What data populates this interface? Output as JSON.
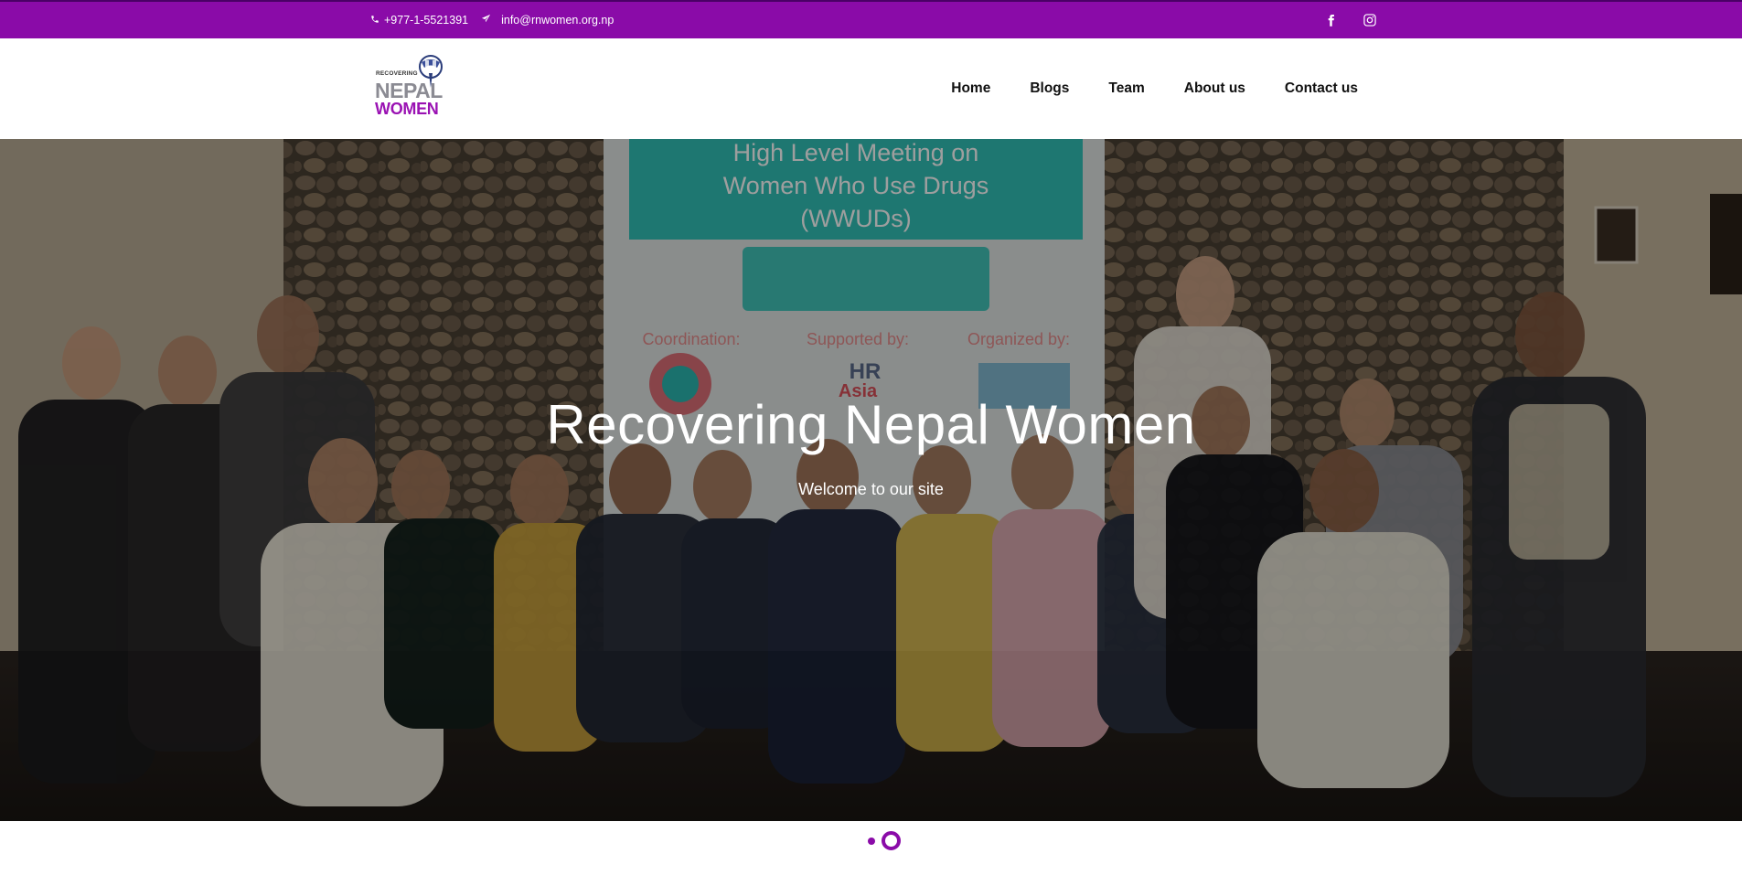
{
  "topbar": {
    "phone": "+977-1-5521391",
    "email": "info@rnwomen.org.np",
    "phone_icon": "phone-icon",
    "email_icon": "paper-plane-icon",
    "social": [
      "facebook-icon",
      "instagram-icon"
    ]
  },
  "logo": {
    "line1": "RECOVERING",
    "line2": "NEPAL",
    "line3": "WOMEN"
  },
  "nav": {
    "items": [
      {
        "label": "Home"
      },
      {
        "label": "Blogs"
      },
      {
        "label": "Team"
      },
      {
        "label": "About us"
      },
      {
        "label": "Contact us"
      }
    ]
  },
  "hero": {
    "title": "Recovering Nepal Women",
    "subtitle": "Welcome to our site",
    "banner": {
      "heading_line1": "High Level Meeting on",
      "heading_line2": "Women Who Use Drugs",
      "heading_line3": "(WWUDs)",
      "coordination": "Coordination:",
      "supported_by": "Supported by:",
      "organized_by": "Organized by:",
      "hr": "HR",
      "asia": "Asia"
    }
  },
  "slider": {
    "count": 2,
    "active_index": 2
  },
  "colors": {
    "brand": "#8a0ba8",
    "brand_dark": "#4a0066"
  }
}
